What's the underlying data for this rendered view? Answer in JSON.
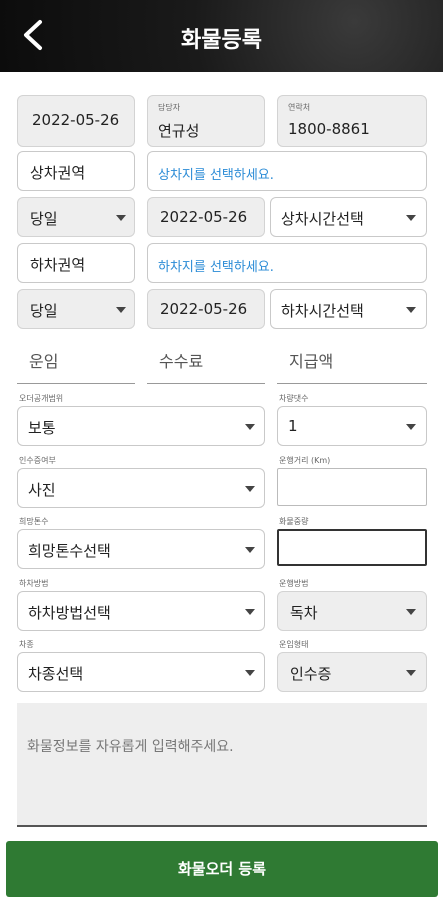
{
  "header": {
    "title": "화물등록",
    "back_icon": "chevron-left-icon"
  },
  "row1": {
    "date": "2022-05-26",
    "manager_label": "담당자",
    "manager_value": "연규성",
    "contact_label": "연락처",
    "contact_value": "1800-8861"
  },
  "pickup": {
    "area_label": "상차권역",
    "place_prompt": "상차지를 선택하세요.",
    "day": "당일",
    "date": "2022-05-26",
    "time_select": "상차시간선택"
  },
  "dropoff": {
    "area_label": "하차권역",
    "place_prompt": "하차지를 선택하세요.",
    "day": "당일",
    "date": "2022-05-26",
    "time_select": "하차시간선택"
  },
  "pricing": {
    "fare": "운임",
    "fee": "수수료",
    "payment": "지급액"
  },
  "order_scope": {
    "label": "오더공개범위",
    "value": "보통"
  },
  "vehicle_count": {
    "label": "차량댓수",
    "value": "1"
  },
  "handover": {
    "label": "인수증여부",
    "value": "사진"
  },
  "distance": {
    "label": "운행거리 (Km)",
    "value": ""
  },
  "tonnage": {
    "label": "희망톤수",
    "value": "희망톤수선택"
  },
  "weight": {
    "label": "화물중량",
    "value": ""
  },
  "unload_method": {
    "label": "하차방법",
    "value": "하차방법선택"
  },
  "operation": {
    "label": "운행방법",
    "value": "독차"
  },
  "car_type": {
    "label": "차종",
    "value": "차종선택"
  },
  "fare_type": {
    "label": "운임형태",
    "value": "인수증"
  },
  "memo": {
    "placeholder": "화물정보를 자유롭게 입력해주세요."
  },
  "submit": {
    "label": "화물오더 등록"
  },
  "colors": {
    "accent": "#2f7a33",
    "link": "#2a8bd6",
    "header": "#1a1a1a"
  }
}
